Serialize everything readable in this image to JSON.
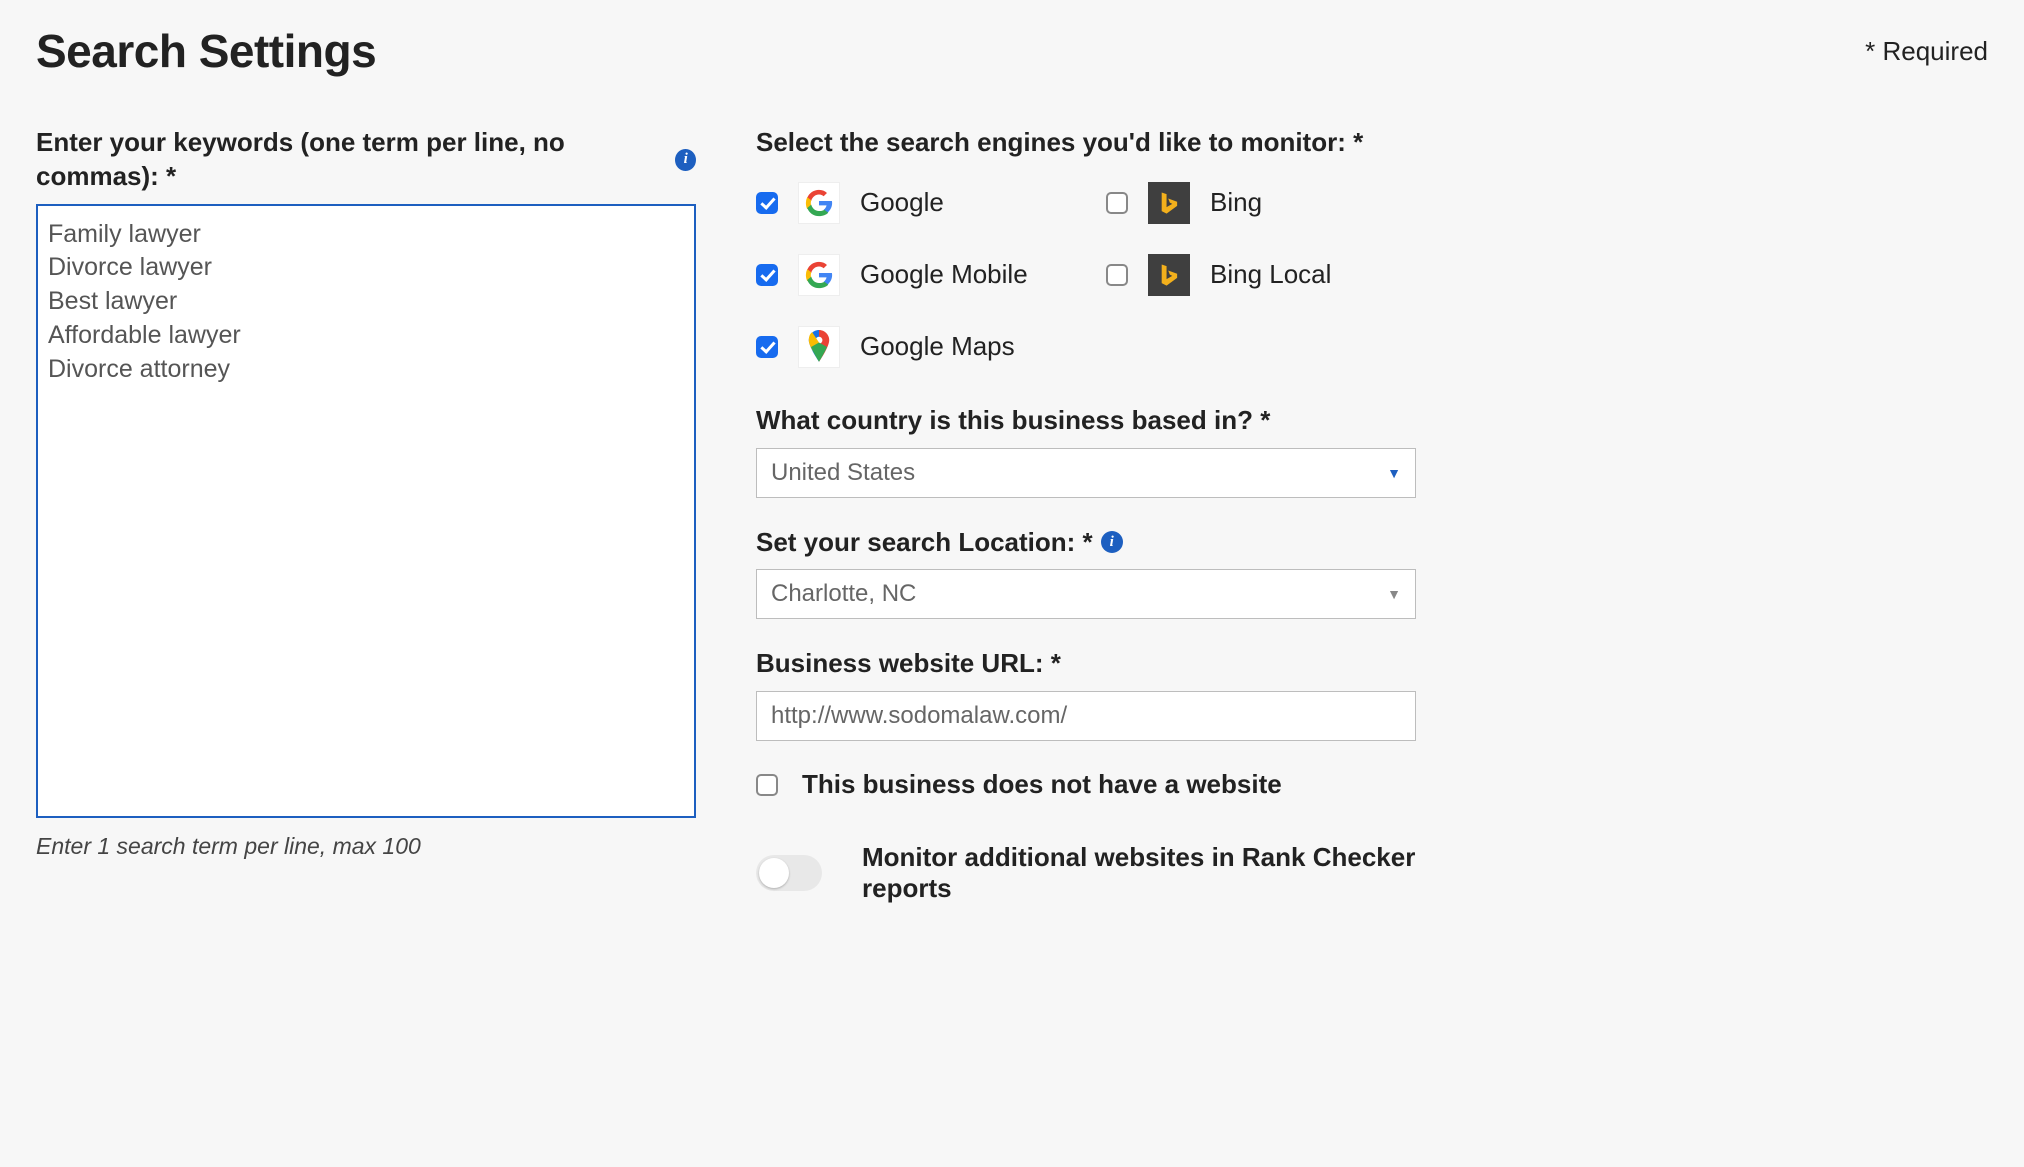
{
  "header": {
    "title": "Search Settings",
    "required": "*   Required"
  },
  "keywords": {
    "label": "Enter your keywords (one term per line, no commas): *",
    "value": "Family lawyer\nDivorce lawyer\nBest lawyer\nAffordable lawyer\nDivorce attorney",
    "hint": "Enter 1 search term per line, max 100"
  },
  "engines": {
    "label": "Select the search engines you'd like to monitor: *",
    "items": [
      {
        "name": "Google",
        "checked": true
      },
      {
        "name": "Bing",
        "checked": false
      },
      {
        "name": "Google Mobile",
        "checked": true
      },
      {
        "name": "Bing Local",
        "checked": false
      },
      {
        "name": "Google Maps",
        "checked": true
      }
    ]
  },
  "country": {
    "label": "What country is this business based in? *",
    "value": "United States"
  },
  "location": {
    "label": "Set your search Location: *",
    "value": "Charlotte, NC"
  },
  "website": {
    "label": "Business website URL: *",
    "value": "http://www.sodomalaw.com/"
  },
  "no_website_label": "This business does not have a website",
  "monitor_label": "Monitor additional websites in Rank Checker reports"
}
